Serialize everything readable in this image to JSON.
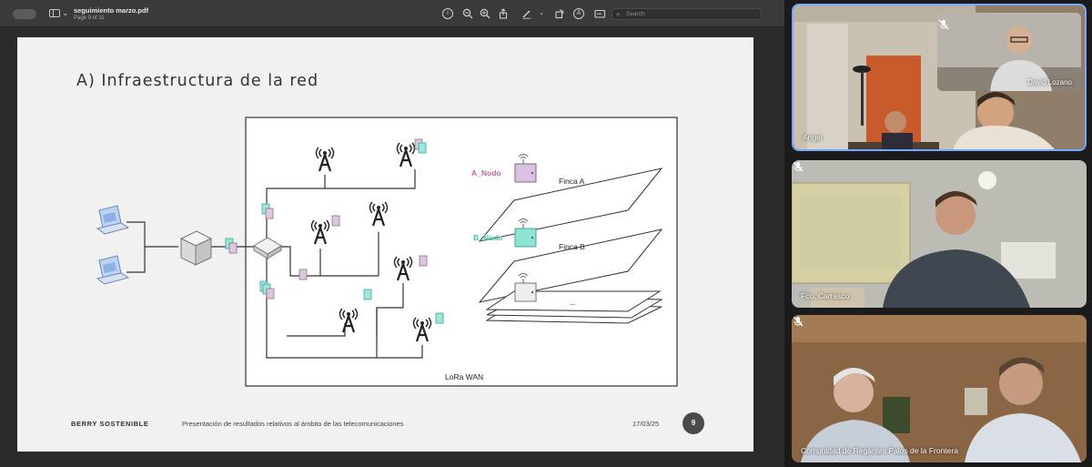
{
  "viewer": {
    "document_title": "seguimiento marzo.pdf",
    "page_indicator": "Page 9 of 11",
    "search_placeholder": "Search",
    "toolbar_icons": [
      "info-icon",
      "zoom-out-icon",
      "zoom-in-icon",
      "share-icon",
      "markup-pen-icon",
      "rotate-icon",
      "annotate-icon",
      "form-fill-icon",
      "search-icon"
    ]
  },
  "slide": {
    "heading": "A) Infraestructura de la red",
    "diagram": {
      "label_node_a": "A_Nodo",
      "label_node_b": "B_Nodo",
      "label_farm_a": "Finca A",
      "label_farm_b": "Finca B",
      "label_more": "...",
      "label_network": "LoRa WAN",
      "color_node_a": "#c7609a",
      "color_node_b": "#3ec9b0"
    },
    "footer": {
      "brand": "BERRY SOSTENIBLE",
      "caption": "Presentación de resultados relativos al ámbito de las telecomunicaciones",
      "date": "17/03/25",
      "page_number": "9"
    }
  },
  "participants": [
    {
      "name": "Angel",
      "self_view_name": "David Lozano",
      "muted": true,
      "active_speaker": true
    },
    {
      "name": "Fco. Carrasco",
      "muted": true,
      "active_speaker": false
    },
    {
      "name": "Comunidad de Regantes Palos de la Frontera",
      "muted": true,
      "active_speaker": false
    }
  ],
  "accent_color": "#79a6ff"
}
